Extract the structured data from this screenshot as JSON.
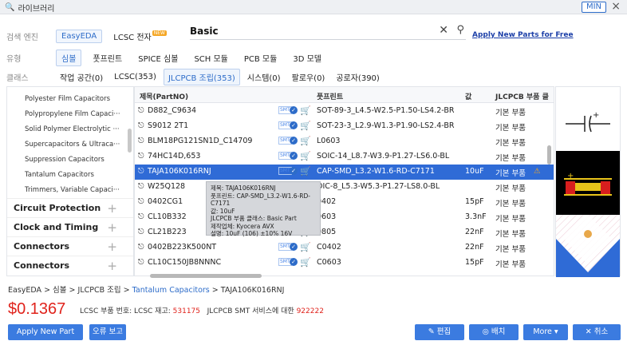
{
  "window": {
    "title": "라이브러리",
    "min_label": "MIN",
    "close_label": "×"
  },
  "filters": {
    "engine_label": "검색 엔진",
    "engines": [
      "EasyEDA",
      "LCSC 전자"
    ],
    "new_badge": "NEW",
    "search_value": "Basic",
    "apply_link": "Apply New Parts for Free",
    "type_label": "유형",
    "types": [
      "심볼",
      "풋프린트",
      "SPICE 심볼",
      "SCH 모듈",
      "PCB 모듈",
      "3D 모델"
    ],
    "class_label": "클래스",
    "classes": [
      "작업 공간(0)",
      "LCSC(353)",
      "JLCPCB 조립(353)",
      "시스템(0)",
      "팔로우(0)",
      "공로자(390)"
    ]
  },
  "sidebar": {
    "subitems": [
      "Polyester Film Capacitors",
      "Polypropylene Film Capaci···",
      "Solid Polymer Electrolytic ···",
      "Supercapacitors & Ultraca···",
      "Suppression Capacitors",
      "Tantalum Capacitors",
      "Trimmers, Variable Capaci···"
    ],
    "categories": [
      "Circuit Protection",
      "Clock and Timing",
      "Connectors",
      "Connectors"
    ]
  },
  "table": {
    "headers": [
      "제목(PartNO)",
      "풋프린트",
      "값",
      "JLCPCB 부품 클"
    ],
    "rows": [
      {
        "name": "D882_C9634",
        "footprint": "SOT-89-3_L4.5-W2.5-P1.50-LS4.2-BR",
        "value": "",
        "cls": "기본 부품"
      },
      {
        "name": "S9012 2T1",
        "footprint": "SOT-23-3_L2.9-W1.3-P1.90-LS2.4-BR",
        "value": "",
        "cls": "기본 부품"
      },
      {
        "name": "BLM18PG121SN1D_C14709",
        "footprint": "L0603",
        "value": "",
        "cls": "기본 부품"
      },
      {
        "name": "74HC14D,653",
        "footprint": "SOIC-14_L8.7-W3.9-P1.27-LS6.0-BL",
        "value": "",
        "cls": "기본 부품"
      },
      {
        "name": "TAJA106K016RNJ",
        "footprint": "CAP-SMD_L3.2-W1.6-RD-C7171",
        "value": "10uF",
        "cls": "기본 부품"
      },
      {
        "name": "W25Q128",
        "footprint": "OIC-8_L5.3-W5.3-P1.27-LS8.0-BL",
        "value": "",
        "cls": "기본 부품"
      },
      {
        "name": "0402CG1",
        "footprint": "0402",
        "value": "15pF",
        "cls": "기본 부품"
      },
      {
        "name": "CL10B332",
        "footprint": "0603",
        "value": "3.3nF",
        "cls": "기본 부품"
      },
      {
        "name": "CL21B223",
        "footprint": "0805",
        "value": "22nF",
        "cls": "기본 부품"
      },
      {
        "name": "0402B223K500NT",
        "footprint": "C0402",
        "value": "22nF",
        "cls": "기본 부품"
      },
      {
        "name": "CL10C150JB8NNNC",
        "footprint": "C0603",
        "value": "15pF",
        "cls": "기본 부품"
      }
    ],
    "smt_label": "SMT",
    "tooltip": [
      "제목: TAJA106K016RNJ",
      "풋프린트: CAP-SMD_L3.2-W1.6-RD-C7171",
      "값: 10uF",
      "JLCPCB 부품 클래스: Basic Part",
      "제작업체: Kyocera AVX",
      "설명: 10uF (106) ±10% 16V"
    ]
  },
  "details": {
    "breadcrumb": [
      "EasyEDA",
      "심볼",
      "JLCPCB 조립",
      "Tantalum Capacitors",
      "TAJA106K016RNJ"
    ],
    "price": "$0.1367",
    "stock_prefix": "LCSC 부품 번호: LCSC 재고:",
    "stock": "531175",
    "smt_prefix": "JLCPCB SMT 서비스에 대한",
    "smt_count": "922222"
  },
  "buttons": {
    "apply_new_part": "Apply New Part",
    "report_error": "오류 보고",
    "edit": "편집",
    "place": "배치",
    "more": "More",
    "cancel": "취소"
  },
  "colors": {
    "accent": "#3b7be0",
    "price": "#e0231c",
    "selected_row": "#2f6bd6"
  }
}
